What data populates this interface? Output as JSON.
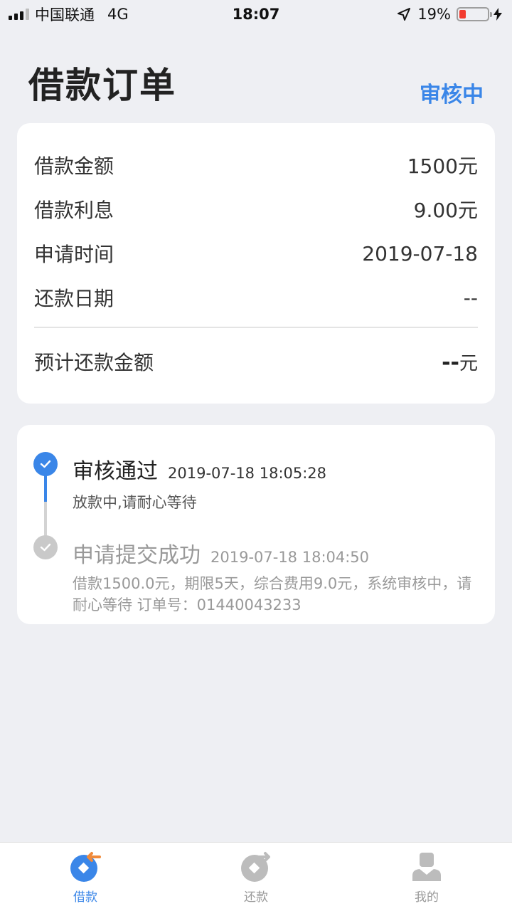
{
  "status_bar": {
    "carrier": "中国联通",
    "network": "4G",
    "time": "18:07",
    "battery": "19%"
  },
  "header": {
    "title": "借款订单",
    "status": "审核中"
  },
  "summary": {
    "rows": [
      {
        "label": "借款金额",
        "value": "1500元"
      },
      {
        "label": "借款利息",
        "value": "9.00元"
      },
      {
        "label": "申请时间",
        "value": "2019-07-18"
      },
      {
        "label": "还款日期",
        "value": "--"
      }
    ],
    "total": {
      "label": "预计还款金额",
      "value": "--",
      "unit": "元"
    }
  },
  "timeline": [
    {
      "title": "审核通过",
      "time": "2019-07-18 18:05:28",
      "desc": "放款中,请耐心等待"
    },
    {
      "title": "申请提交成功",
      "time": "2019-07-18 18:04:50",
      "desc": "借款1500.0元，期限5天，综合费用9.0元，系统审核中，请耐心等待 订单号：01440043233"
    }
  ],
  "tabbar": {
    "items": [
      {
        "label": "借款",
        "active": true
      },
      {
        "label": "还款",
        "active": false
      },
      {
        "label": "我的",
        "active": false
      }
    ]
  },
  "colors": {
    "accent": "#3a86e8",
    "background": "#eeeff3",
    "battery_low": "#f23b2f"
  }
}
